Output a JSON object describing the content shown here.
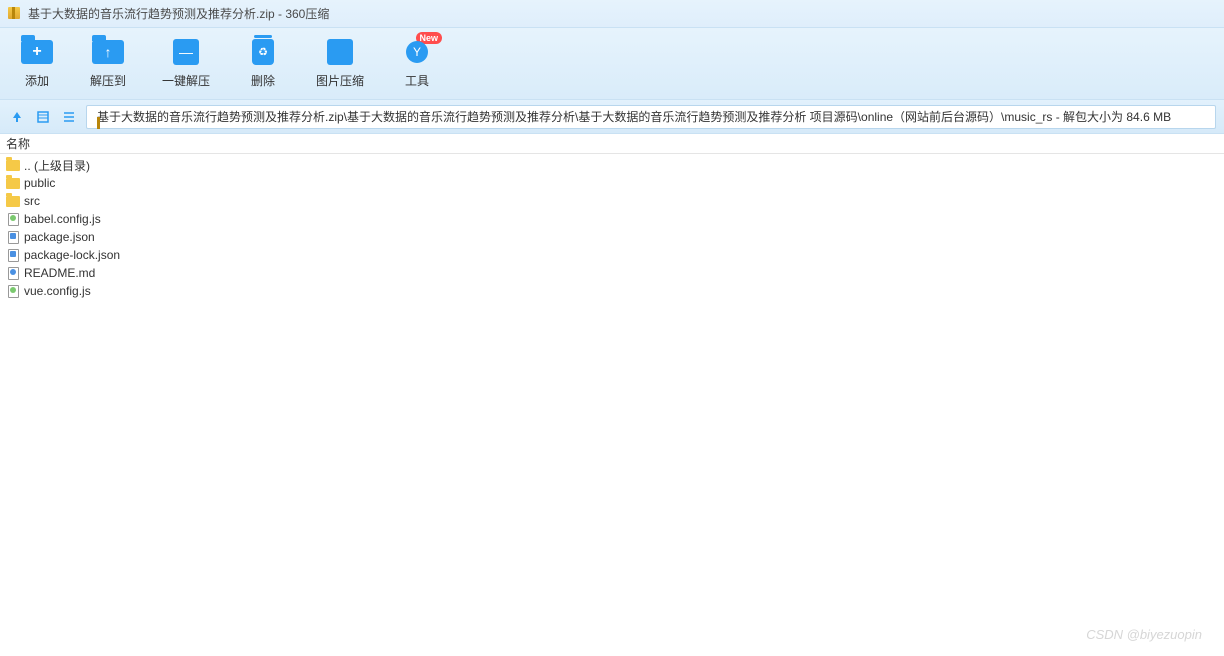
{
  "titlebar": {
    "text": "基于大数据的音乐流行趋势预测及推荐分析.zip - 360压缩"
  },
  "toolbar": {
    "add": "添加",
    "extract_to": "解压到",
    "one_click": "一键解压",
    "delete": "删除",
    "image_compress": "图片压缩",
    "tools": "工具",
    "new_badge": "New"
  },
  "pathbar": {
    "path": "基于大数据的音乐流行趋势预测及推荐分析.zip\\基于大数据的音乐流行趋势预测及推荐分析\\基于大数据的音乐流行趋势预测及推荐分析 项目源码\\online（网站前后台源码）\\music_rs - 解包大小为 84.6 MB"
  },
  "columns": {
    "name": "名称"
  },
  "files": [
    {
      "name": ".. (上级目录)",
      "type": "folder"
    },
    {
      "name": "public",
      "type": "folder"
    },
    {
      "name": "src",
      "type": "folder"
    },
    {
      "name": "babel.config.js",
      "type": "js"
    },
    {
      "name": "package.json",
      "type": "json"
    },
    {
      "name": "package-lock.json",
      "type": "json"
    },
    {
      "name": "README.md",
      "type": "md"
    },
    {
      "name": "vue.config.js",
      "type": "js"
    }
  ],
  "watermark": "CSDN @biyezuopin"
}
